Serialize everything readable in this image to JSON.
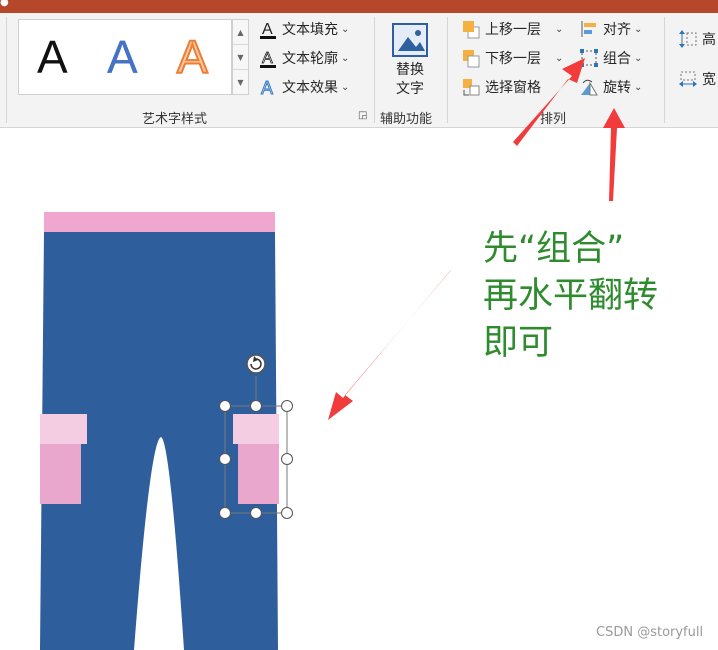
{
  "ribbon": {
    "wordart": {
      "group_label": "艺术字样式",
      "sample_letter": "A",
      "text_fill": "文本填充",
      "text_outline": "文本轮廓",
      "text_effects": "文本效果"
    },
    "accessibility": {
      "group_label": "辅助功能",
      "alt_text_line1": "替换",
      "alt_text_line2": "文字"
    },
    "arrange": {
      "group_label": "排列",
      "bring_forward": "上移一层",
      "send_backward": "下移一层",
      "selection_pane": "选择窗格",
      "align": "对齐",
      "group": "组合",
      "rotate": "旋转"
    },
    "size": {
      "height_label": "高",
      "width_label": "宽"
    }
  },
  "annotation": {
    "line1": "先“组合”",
    "line2": "再水平翻转",
    "line3": "即可"
  },
  "watermark": "CSDN @storyfull",
  "colors": {
    "title_bar": "#b7472a",
    "pants_body": "#2f5e9c",
    "waistband": "#efa7cf",
    "pocket_flap": "#f4cde3",
    "pocket": "#eaa7cd",
    "annotation_text": "#2e8b2e",
    "arrow": "#f23b3b"
  }
}
